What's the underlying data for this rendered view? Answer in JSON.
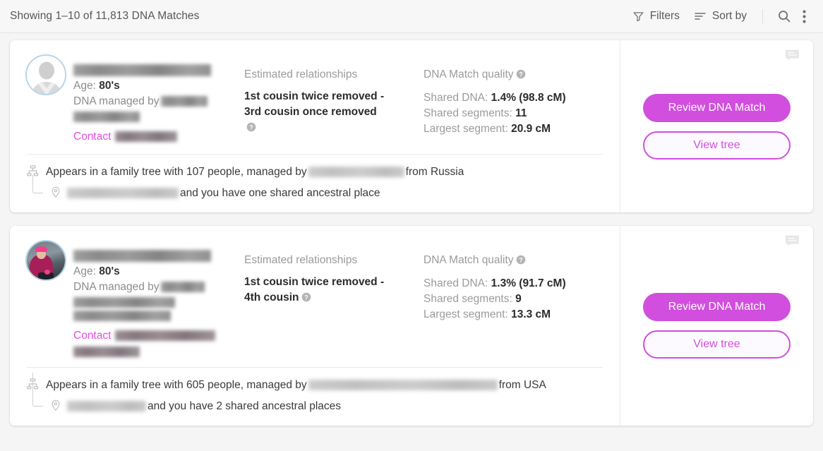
{
  "toolbar": {
    "count_text": "Showing 1–10 of 11,813 DNA Matches",
    "filters_label": "Filters",
    "sort_label": "Sort by",
    "filters_icon": "filter-funnel-icon",
    "sort_icon": "sort-lines-icon",
    "search_icon": "search-icon",
    "more_icon": "more-vertical-icon"
  },
  "labels": {
    "estimated_relationships": "Estimated relationships",
    "dna_match_quality": "DNA Match quality",
    "age_prefix": "Age: ",
    "managed_by_prefix": "DNA managed by",
    "contact": "Contact",
    "shared_dna_prefix": "Shared DNA: ",
    "shared_segments_prefix": "Shared segments: ",
    "largest_segment_prefix": "Largest segment: ",
    "review_button": "Review DNA Match",
    "view_tree_button": "View tree"
  },
  "colors": {
    "accent": "#d14ede",
    "contact_link": "#e14fe0",
    "page_background": "#f5f5f5",
    "card_background": "#ffffff",
    "avatar_ring": "#b6d4e8"
  },
  "matches": [
    {
      "avatar_type": "default-silhouette",
      "name": "[redacted]",
      "age": "80's",
      "manager": "[redacted]",
      "contact_name": "[redacted]",
      "relationship": "1st cousin twice removed - 3rd cousin once removed",
      "shared_dna": "1.4% (98.8 cM)",
      "shared_segments": "11",
      "largest_segment": "20.9 cM",
      "tree_text_before": "Appears in a family tree with 107 people, managed by",
      "tree_manager": "[redacted]",
      "tree_text_after": "from Russia",
      "place_name": "[redacted]",
      "place_text": "and you have one shared ancestral place",
      "review_button": "Review DNA Match",
      "view_tree_button": "View tree"
    },
    {
      "avatar_type": "user-photo",
      "name": "[redacted]",
      "age": "80's",
      "manager": "[redacted]",
      "contact_name": "[redacted]",
      "relationship": "1st cousin twice removed - 4th cousin",
      "shared_dna": "1.3% (91.7 cM)",
      "shared_segments": "9",
      "largest_segment": "13.3 cM",
      "tree_text_before": "Appears in a family tree with 605 people, managed by",
      "tree_manager": "[redacted]",
      "tree_text_after": "from USA",
      "place_name": "[redacted]",
      "place_text": "and you have 2 shared ancestral places",
      "review_button": "Review DNA Match",
      "view_tree_button": "View tree"
    }
  ]
}
